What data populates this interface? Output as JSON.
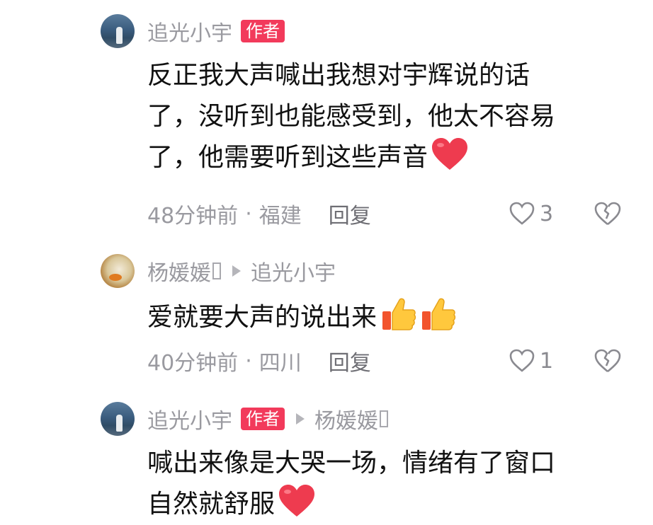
{
  "comments": [
    {
      "author": "追光小宇",
      "badge": "作者",
      "text_lines": [
        "反正我大声喊出我想对宇辉说的话",
        "了，没听到也能感受到，他太不容易",
        "了，他需要听到这些声音"
      ],
      "time": "48分钟前",
      "location": "福建",
      "reply_label": "回复",
      "likes": "3",
      "avatar_icon": "sea-photo-avatar",
      "emoji": "red-heart-emoji"
    },
    {
      "author": "杨媛媛",
      "reply_to": "追光小宇",
      "text": "爱就要大声的说出来",
      "time": "40分钟前",
      "location": "四川",
      "reply_label": "回复",
      "likes": "1",
      "avatar_icon": "bird-photo-avatar",
      "emoji": "thumbs-up-emoji"
    },
    {
      "author": "追光小宇",
      "badge": "作者",
      "reply_to": "杨媛媛",
      "text_lines": [
        "喊出来像是大哭一场，情绪有了窗口",
        "自然就舒服"
      ],
      "avatar_icon": "sea-photo-avatar",
      "emoji": "red-heart-emoji"
    }
  ],
  "dot_separator": "·",
  "colors": {
    "badge": "#f23a5b",
    "meta": "#9a9aa0",
    "text": "#111111"
  }
}
